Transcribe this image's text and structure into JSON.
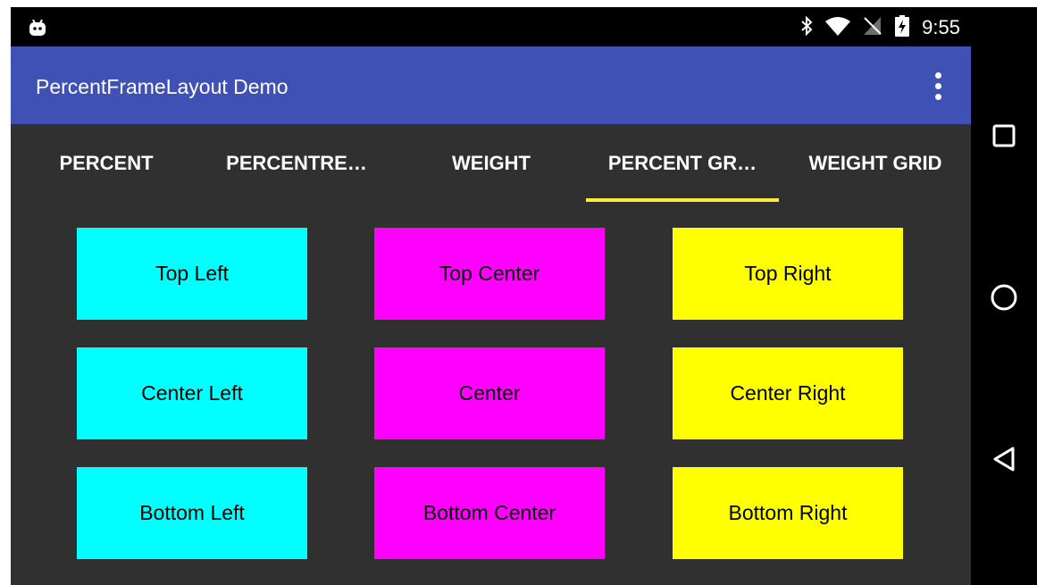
{
  "status_bar": {
    "time": "9:55",
    "icons": [
      "android-robot-icon",
      "bluetooth-icon",
      "wifi-icon",
      "no-sim-icon",
      "battery-charging-icon"
    ]
  },
  "app_bar": {
    "title": "PercentFrameLayout Demo",
    "overflow_icon": "more-vertical-icon",
    "color": "#3f51b5"
  },
  "tabs": [
    {
      "label": "PERCENT",
      "selected": false
    },
    {
      "label": "PERCENTRE…",
      "selected": false
    },
    {
      "label": "WEIGHT",
      "selected": false
    },
    {
      "label": "PERCENT GR…",
      "selected": true
    },
    {
      "label": "WEIGHT GRID",
      "selected": false
    }
  ],
  "tab_indicator_color": "#ffeb3b",
  "grid": {
    "cells": [
      {
        "label": "Top Left",
        "color": "#00ffff"
      },
      {
        "label": "Top Center",
        "color": "#ff00ff"
      },
      {
        "label": "Top Right",
        "color": "#ffff00"
      },
      {
        "label": "Center Left",
        "color": "#00ffff"
      },
      {
        "label": "Center",
        "color": "#ff00ff"
      },
      {
        "label": "Center Right",
        "color": "#ffff00"
      },
      {
        "label": "Bottom Left",
        "color": "#00ffff"
      },
      {
        "label": "Bottom Center",
        "color": "#ff00ff"
      },
      {
        "label": "Bottom Right",
        "color": "#ffff00"
      }
    ]
  },
  "nav_bar": {
    "buttons": [
      "recents-square-icon",
      "home-circle-icon",
      "back-triangle-icon"
    ]
  }
}
